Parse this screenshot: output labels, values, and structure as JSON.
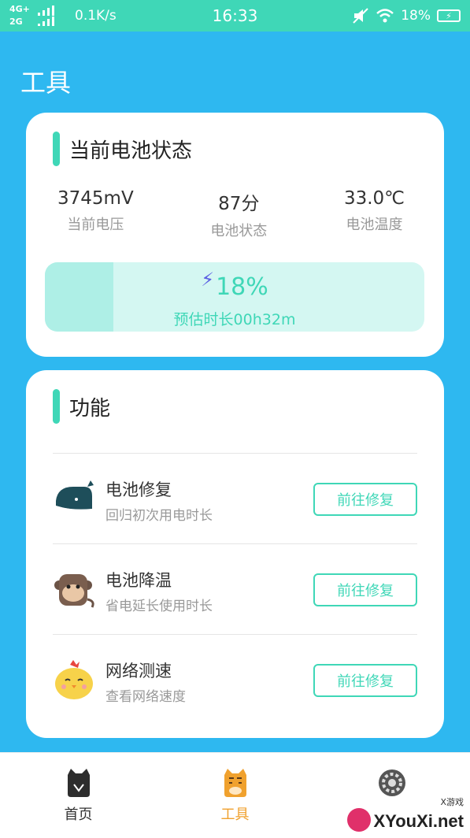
{
  "status_bar": {
    "net_top": "4G+",
    "net_bottom": "2G",
    "speed": "0.1K/s",
    "time": "16:33",
    "battery": "18%"
  },
  "page": {
    "title": "工具"
  },
  "battery_card": {
    "title": "当前电池状态",
    "stats": [
      {
        "value": "3745mV",
        "label": "当前电压"
      },
      {
        "value": "87分",
        "label": "电池状态"
      },
      {
        "value": "33.0℃",
        "label": "电池温度"
      }
    ],
    "percent": "18%",
    "percent_value": 0.18,
    "estimate": "预估时长00h32m"
  },
  "features_card": {
    "title": "功能",
    "rows": [
      {
        "title": "电池修复",
        "subtitle": "回归初次用电时长",
        "button": "前往修复",
        "icon": "whale-icon"
      },
      {
        "title": "电池降温",
        "subtitle": "省电延长使用时长",
        "button": "前往修复",
        "icon": "monkey-icon"
      },
      {
        "title": "网络测速",
        "subtitle": "查看网络速度",
        "button": "前往修复",
        "icon": "chick-icon"
      }
    ]
  },
  "tabbar": {
    "tabs": [
      {
        "label": "首页",
        "icon": "cat-icon",
        "active": false
      },
      {
        "label": "工具",
        "icon": "tiger-icon",
        "active": true
      },
      {
        "label": "",
        "icon": "gear-icon",
        "active": false
      }
    ]
  },
  "watermark": {
    "text": "XYouXi.net",
    "small": "X游戏"
  },
  "colors": {
    "accent": "#3FD7B7",
    "background": "#2EB8F0",
    "tab_active": "#F0A12E"
  }
}
